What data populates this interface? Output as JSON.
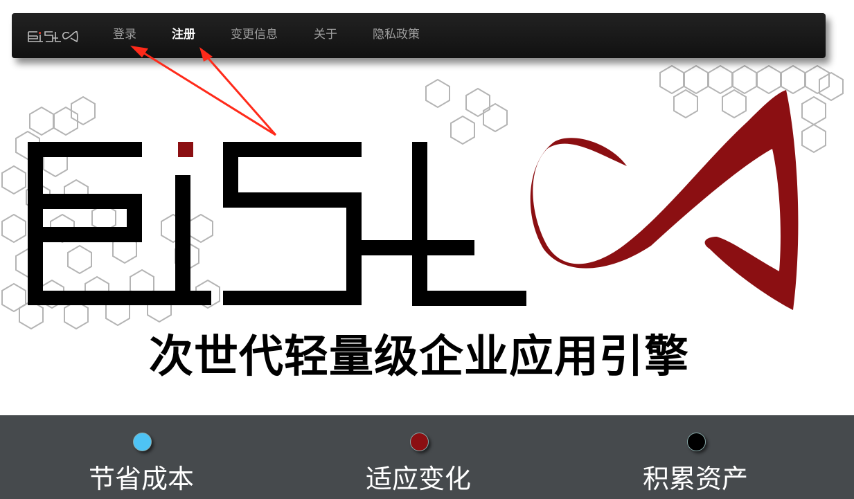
{
  "navbar": {
    "brand_label": "EiSLS",
    "items": [
      {
        "label": "登录",
        "active": false
      },
      {
        "label": "注册",
        "active": true
      },
      {
        "label": "变更信息",
        "active": false
      },
      {
        "label": "关于",
        "active": false
      },
      {
        "label": "隐私政策",
        "active": false
      }
    ]
  },
  "hero": {
    "logo_name": "EiSLS",
    "tagline": "次世代轻量级企业应用引擎"
  },
  "features": [
    {
      "label": "节省成本",
      "dot_color": "#4ec3f5"
    },
    {
      "label": "适应变化",
      "dot_color": "#8b0f12"
    },
    {
      "label": "积累资产",
      "dot_color": "#000000"
    }
  ],
  "colors": {
    "brand_red": "#8b0f12",
    "navbar_bg": "#1b1b1b",
    "features_bg": "#464a4d",
    "annotation_red": "#ff2a1a"
  }
}
